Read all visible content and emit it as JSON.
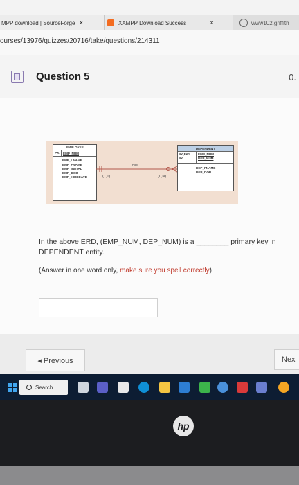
{
  "browser": {
    "tabs": [
      {
        "label": "MPP download | SourceForge",
        "close": "×"
      },
      {
        "label": "XAMPP Download Success",
        "close": "×"
      },
      {
        "label": "www102.griffith"
      }
    ],
    "url": "ourses/13976/quizzes/20716/take/questions/214311"
  },
  "question": {
    "title": "Question 5",
    "points": "0.",
    "erd": {
      "employee": {
        "name": "EMPLOYEE",
        "pk_label": "PK",
        "pk": "EMP_NUM",
        "attributes": [
          "EMP_LNAME",
          "EMP_FNAME",
          "EMP_INITIAL",
          "EMP_DOB",
          "EMP_HIREDATE"
        ]
      },
      "relationship": "has",
      "card_left": "(1,1)",
      "card_right": "(0,N)",
      "dependent": {
        "name": "DEPENDENT",
        "key_labels": [
          "PK,FK1",
          "PK"
        ],
        "keys": [
          "EMP_NUM",
          "DEP_NUM"
        ],
        "attributes": [
          "DEP_FNAME",
          "DEP_DOB"
        ]
      }
    },
    "text_part1": "In the above ERD, (EMP_NUM, DEP_NUM) is a ________ primary key in",
    "text_part2": "DEPENDENT entity.",
    "hint_start": "(Answer in one word only, ",
    "hint_red": "make sure you spell correctly",
    "hint_end": ")",
    "answer_value": ""
  },
  "nav": {
    "previous": "◂ Previous",
    "next": "Nex"
  },
  "taskbar": {
    "search": "Search"
  },
  "laptop": {
    "logo": "hp"
  },
  "colors": {
    "accent_red": "#c0392b",
    "taskbar": "#0d1d33",
    "erd_bg": "#f2dfd1"
  }
}
